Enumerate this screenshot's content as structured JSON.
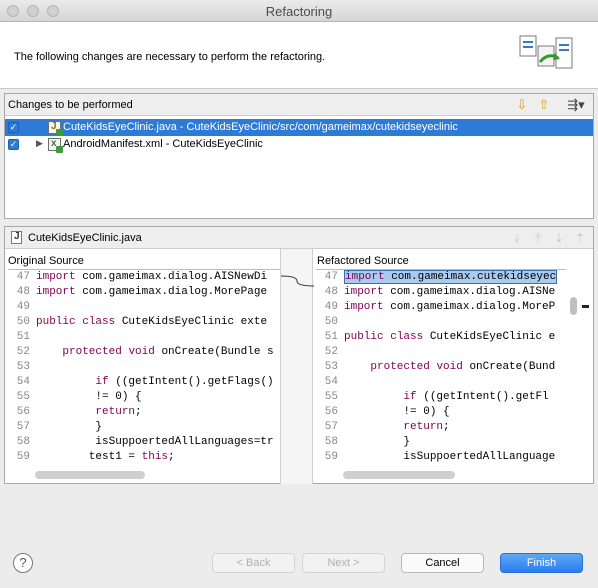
{
  "window": {
    "title": "Refactoring"
  },
  "header": {
    "message": "The following changes are necessary to perform the refactoring."
  },
  "changes": {
    "heading": "Changes to be performed",
    "items": [
      {
        "label": "CuteKidsEyeClinic.java - CuteKidsEyeClinic/src/com/gameimax/cutekidseyeclinic",
        "checked": true,
        "selected": true
      },
      {
        "label": "AndroidManifest.xml - CuteKidsEyeClinic",
        "checked": true,
        "selected": false
      }
    ]
  },
  "compare": {
    "filename": "CuteKidsEyeClinic.java",
    "original_title": "Original Source",
    "refactored_title": "Refactored Source",
    "original_lines": [
      {
        "n": "47",
        "t": "import com.gameimax.dialog.AISNewDi"
      },
      {
        "n": "48",
        "t": "import com.gameimax.dialog.MorePage"
      },
      {
        "n": "49",
        "t": ""
      },
      {
        "n": "50",
        "t": "public class CuteKidsEyeClinic exte"
      },
      {
        "n": "51",
        "t": ""
      },
      {
        "n": "52",
        "t": "    protected void onCreate(Bundle s"
      },
      {
        "n": "53",
        "t": ""
      },
      {
        "n": "54",
        "t": "         if ((getIntent().getFlags()"
      },
      {
        "n": "55",
        "t": "         != 0) {"
      },
      {
        "n": "56",
        "t": "         return;"
      },
      {
        "n": "57",
        "t": "         }"
      },
      {
        "n": "58",
        "t": "         isSuppoertedAllLanguages=tr"
      },
      {
        "n": "59",
        "t": "        test1 = this;"
      }
    ],
    "refactored_lines": [
      {
        "n": "47",
        "t": "import com.gameimax.cutekidseyec",
        "hl": true
      },
      {
        "n": "48",
        "t": "import com.gameimax.dialog.AISNe"
      },
      {
        "n": "49",
        "t": "import com.gameimax.dialog.MoreP"
      },
      {
        "n": "50",
        "t": ""
      },
      {
        "n": "51",
        "t": "public class CuteKidsEyeClinic e"
      },
      {
        "n": "52",
        "t": ""
      },
      {
        "n": "53",
        "t": "    protected void onCreate(Bund"
      },
      {
        "n": "54",
        "t": ""
      },
      {
        "n": "55",
        "t": "         if ((getIntent().getFl"
      },
      {
        "n": "56",
        "t": "         != 0) {"
      },
      {
        "n": "57",
        "t": "         return;"
      },
      {
        "n": "58",
        "t": "         }"
      },
      {
        "n": "59",
        "t": "         isSuppoertedAllLanguage"
      }
    ]
  },
  "buttons": {
    "back": "< Back",
    "next": "Next >",
    "cancel": "Cancel",
    "finish": "Finish",
    "help": "?"
  },
  "icons": {
    "move_down": "arrow-down-icon",
    "move_up": "arrow-up-icon",
    "filter": "filter-menu-icon"
  },
  "colors": {
    "selection": "#2e7ad7",
    "primary_button": "#2a7cf0",
    "keyword": "#7f0055"
  }
}
